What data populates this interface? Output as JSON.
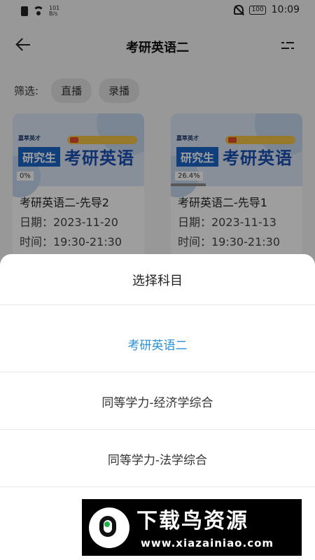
{
  "status": {
    "network_speed": "101\nB/s",
    "time": "10:09",
    "battery": "100"
  },
  "header": {
    "title": "考研英语二",
    "back_icon": "arrow-left-icon",
    "filter_icon": "filter-icon"
  },
  "filter": {
    "label": "筛选:",
    "chips": [
      "直播",
      "录播"
    ]
  },
  "cards": [
    {
      "thumb_brand": "嘉萃英才",
      "thumb_tag": "研究生",
      "thumb_title": "考研英语",
      "progress_label": "0%",
      "progress": 0,
      "name": "考研英语二-先导2",
      "date": "日期：2023-11-20",
      "time": "时间：19:30-21:30"
    },
    {
      "thumb_brand": "嘉萃英才",
      "thumb_tag": "研究生",
      "thumb_title": "考研英语",
      "progress_label": "26.4%",
      "progress": 0.264,
      "name": "考研英语二-先导1",
      "date": "日期：2023-11-13",
      "time": "时间：19:30-21:30"
    }
  ],
  "sheet": {
    "title": "选择科目",
    "options": [
      {
        "label": "考研英语二",
        "selected": true
      },
      {
        "label": "同等学力-经济学综合",
        "selected": false
      },
      {
        "label": "同等学力-法学综合",
        "selected": false
      }
    ]
  },
  "watermark": {
    "name": "下载鸟资源",
    "url": "www.xiazainiao.com"
  },
  "colors": {
    "accent": "#2b8fd6",
    "overlay": "rgba(0,0,0,0.38)"
  }
}
